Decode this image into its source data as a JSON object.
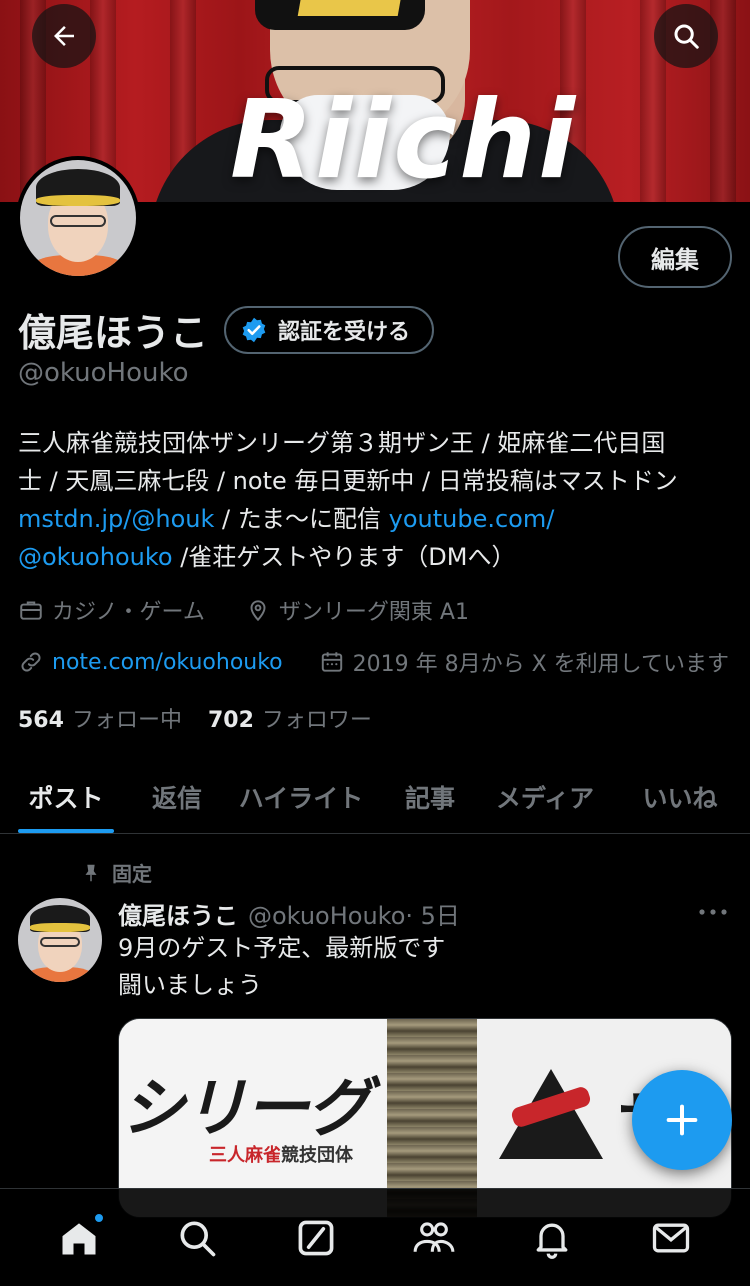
{
  "banner": {
    "title": "Riichi"
  },
  "header": {
    "back_icon": "arrow-left-icon",
    "search_icon": "search-icon"
  },
  "profile": {
    "display_name": "億尾ほうこ",
    "verify_label": "認証を受ける",
    "handle": "@okuoHouko",
    "edit_label": "編集",
    "bio": {
      "line1": "三人麻雀競技団体ザンリーグ第３期ザン王 / 姫麻雀二代目国",
      "line2": "士 / 天鳳三麻七段 / note 毎日更新中 / 日常投稿はマストドン",
      "link1": "mstdn.jp/@houk",
      "line3_mid": " / たま～に配信 ",
      "link2": "youtube.com/",
      "link2b": "@okuohouko",
      "line4_end": " /雀荘ゲストやります（DMへ）"
    },
    "category": "カジノ・ゲーム",
    "location": "ザンリーグ関東 A1",
    "website": "note.com/okuohouko",
    "joined": "2019 年 8月から X を利用しています",
    "following_count": "564",
    "following_label": "フォロー中",
    "followers_count": "702",
    "followers_label": "フォロワー"
  },
  "tabs": [
    {
      "label": "ポスト",
      "active": true
    },
    {
      "label": "返信"
    },
    {
      "label": "ハイライト"
    },
    {
      "label": "記事"
    },
    {
      "label": "メディア"
    },
    {
      "label": "いいね"
    }
  ],
  "pinned_post": {
    "pinned_label": "固定",
    "name": "億尾ほうこ",
    "handle": "@okuoHouko",
    "time": "· 5日",
    "text_line1": "9月のゲスト予定、最新版です",
    "text_line2": "闘いましょう",
    "media_text_big": "シリーグ",
    "media_text_sub_red": "三人麻雀",
    "media_text_sub": "競技団体",
    "media_text_right": "ザ"
  },
  "bottom_nav": [
    "home-icon",
    "search-icon",
    "grok-icon",
    "communities-icon",
    "notifications-icon",
    "messages-icon"
  ],
  "colors": {
    "accent": "#1d9bf0",
    "bg": "#000000",
    "muted": "#71767b",
    "banner_red": "#b51c20"
  }
}
